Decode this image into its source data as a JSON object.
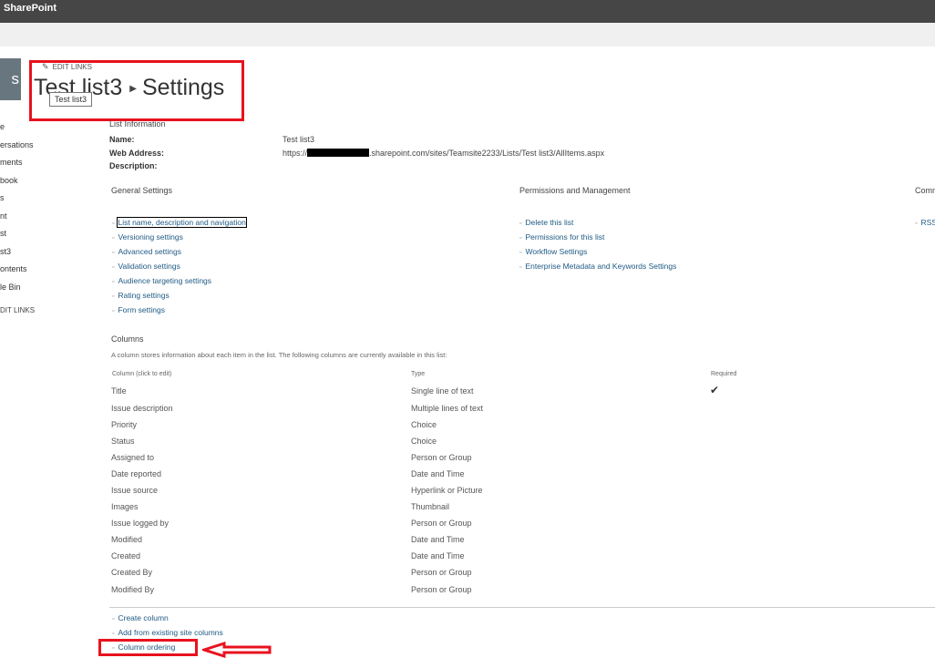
{
  "app": {
    "brand": "SharePoint"
  },
  "site": {
    "logo_text": "s"
  },
  "left_nav": {
    "items": [
      "e",
      "ersations",
      "ments",
      "book",
      "s",
      "nt",
      "st",
      "st3",
      "ontents",
      "le Bin"
    ],
    "edit_links": "DIT LINKS"
  },
  "header": {
    "edit_links": "EDIT LINKS",
    "list_name": "Test list3",
    "page": "Settings",
    "tooltip": "Test list3"
  },
  "list_info": {
    "section_title": "List Information",
    "name_label": "Name:",
    "name_value": "Test list3",
    "web_address_label": "Web Address:",
    "web_address_prefix": "https://",
    "web_address_suffix": ".sharepoint.com/sites/Teamsite2233/Lists/Test list3/AllItems.aspx",
    "description_label": "Description:"
  },
  "general_settings": {
    "title": "General Settings",
    "links": [
      "List name, description and navigation",
      "Versioning settings",
      "Advanced settings",
      "Validation settings",
      "Audience targeting settings",
      "Rating settings",
      "Form settings"
    ]
  },
  "permissions": {
    "title": "Permissions and Management",
    "links": [
      "Delete this list",
      "Permissions for this list",
      "Workflow Settings",
      "Enterprise Metadata and Keywords Settings"
    ]
  },
  "communications": {
    "title": "Comm",
    "links": [
      "RSS"
    ]
  },
  "columns": {
    "title": "Columns",
    "description": "A column stores information about each item in the list. The following columns are currently available in this list:",
    "headers": [
      "Column (click to edit)",
      "Type",
      "Required"
    ],
    "rows": [
      {
        "name": "Title",
        "type": "Single line of text",
        "required": "✔"
      },
      {
        "name": "Issue description",
        "type": "Multiple lines of text",
        "required": ""
      },
      {
        "name": "Priority",
        "type": "Choice",
        "required": ""
      },
      {
        "name": "Status",
        "type": "Choice",
        "required": ""
      },
      {
        "name": "Assigned to",
        "type": "Person or Group",
        "required": ""
      },
      {
        "name": "Date reported",
        "type": "Date and Time",
        "required": ""
      },
      {
        "name": "Issue source",
        "type": "Hyperlink or Picture",
        "required": ""
      },
      {
        "name": "Images",
        "type": "Thumbnail",
        "required": ""
      },
      {
        "name": "Issue logged by",
        "type": "Person or Group",
        "required": ""
      },
      {
        "name": "Modified",
        "type": "Date and Time",
        "required": ""
      },
      {
        "name": "Created",
        "type": "Date and Time",
        "required": ""
      },
      {
        "name": "Created By",
        "type": "Person or Group",
        "required": ""
      },
      {
        "name": "Modified By",
        "type": "Person or Group",
        "required": ""
      }
    ]
  },
  "column_actions": [
    "Create column",
    "Add from existing site columns",
    "Column ordering"
  ],
  "icons": {
    "bullet": "▫",
    "pencil": "✎",
    "breadcrumb_arrow": "▶",
    "check": "✔"
  },
  "colors": {
    "link": "#1f5a84",
    "annotation": "#e8121e",
    "topbar": "#464646"
  }
}
